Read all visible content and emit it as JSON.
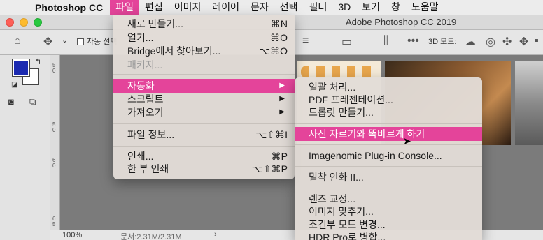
{
  "menubar": {
    "apple_icon": "apple-logo",
    "app_name": "Photoshop CC",
    "items": [
      "파일",
      "편집",
      "이미지",
      "레이어",
      "문자",
      "선택",
      "필터",
      "3D",
      "보기",
      "창",
      "도움말"
    ]
  },
  "window": {
    "title": "Adobe Photoshop CC 2019"
  },
  "options": {
    "auto_select": "자동 선택",
    "mode_3d": "3D 모드:"
  },
  "ruler": [
    "5",
    "0",
    "5",
    "0",
    "6",
    "0",
    "6",
    "5"
  ],
  "file_menu": {
    "new": "새로 만들기...",
    "new_sc": "⌘N",
    "open": "열기...",
    "open_sc": "⌘O",
    "bridge": "Bridge에서 찾아보기...",
    "bridge_sc": "⌥⌘O",
    "package": "패키지...",
    "automate": "자동화",
    "scripts": "스크립트",
    "import": "가져오기",
    "file_info": "파일 정보...",
    "file_info_sc": "⌥⇧⌘I",
    "print": "인쇄...",
    "print_sc": "⌘P",
    "print_one": "한 부 인쇄",
    "print_one_sc": "⌥⇧⌘P"
  },
  "automate_menu": {
    "batch": "일괄 처리...",
    "pdf": "PDF 프레젠테이션...",
    "droplet": "드롭릿 만들기...",
    "crop": "사진 자르기와 똑바르게 하기",
    "imagenomic": "Imagenomic Plug-in Console...",
    "contact": "밀착 인화 II...",
    "lens": "렌즈 교정...",
    "fit": "이미지 맞추기...",
    "conditional": "조건부 모드 변경...",
    "hdr": "HDR Pro로 병합..."
  },
  "status": {
    "zoom": "100%",
    "doc": "문서:2.31M/2.31M",
    "arrow": "›"
  },
  "colors": {
    "accent": "#e4449a",
    "foreground_swatch": "#1b2ab0"
  }
}
